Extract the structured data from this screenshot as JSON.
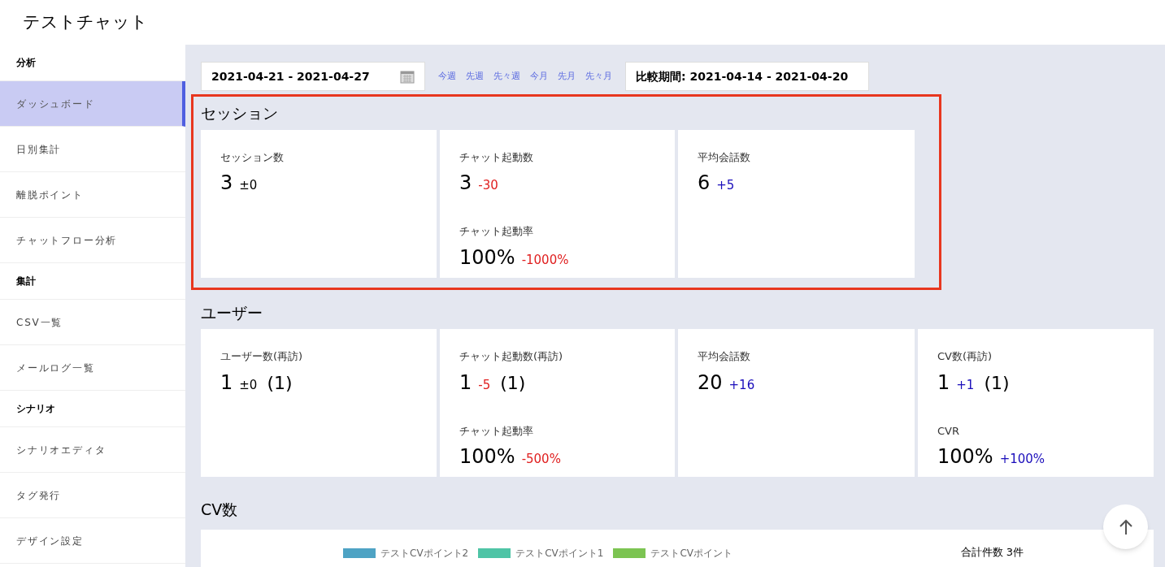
{
  "app": {
    "title": "テストチャット"
  },
  "sidebar": {
    "sections": [
      {
        "label": "分析",
        "items": [
          {
            "label": "ダッシュボード",
            "selected": true
          },
          {
            "label": "日別集計",
            "selected": false
          },
          {
            "label": "離脱ポイント",
            "selected": false
          },
          {
            "label": "チャットフロー分析",
            "selected": false
          }
        ]
      },
      {
        "label": "集計",
        "items": [
          {
            "label": "CSV一覧",
            "selected": false
          },
          {
            "label": "メールログ一覧",
            "selected": false
          }
        ]
      },
      {
        "label": "シナリオ",
        "items": [
          {
            "label": "シナリオエディタ",
            "selected": false
          },
          {
            "label": "タグ発行",
            "selected": false
          },
          {
            "label": "デザイン設定",
            "selected": false
          }
        ]
      }
    ]
  },
  "filters": {
    "date_range": "2021-04-21 - 2021-04-27",
    "presets": [
      "今週",
      "先週",
      "先々週",
      "今月",
      "先月",
      "先々月"
    ],
    "compare": "比較期間: 2021-04-14 - 2021-04-20"
  },
  "sections": [
    {
      "title": "セッション",
      "highlighted": true,
      "cards": [
        {
          "metrics": [
            {
              "label": "セッション数",
              "value": "3",
              "delta": "±0",
              "kind": "even"
            }
          ]
        },
        {
          "metrics": [
            {
              "label": "チャット起動数",
              "value": "3",
              "delta": "-30",
              "kind": "down"
            },
            {
              "label": "チャット起動率",
              "value": "100%",
              "delta": "-1000%",
              "kind": "down"
            }
          ]
        },
        {
          "metrics": [
            {
              "label": "平均会話数",
              "value": "6",
              "delta": "+5",
              "kind": "up"
            }
          ]
        }
      ]
    },
    {
      "title": "ユーザー",
      "highlighted": false,
      "cards": [
        {
          "metrics": [
            {
              "label": "ユーザー数(再訪)",
              "value": "1",
              "delta": "±0",
              "kind": "even",
              "revisit": "(1)"
            }
          ]
        },
        {
          "metrics": [
            {
              "label": "チャット起動数(再訪)",
              "value": "1",
              "delta": "-5",
              "kind": "down",
              "revisit": "(1)"
            },
            {
              "label": "チャット起動率",
              "value": "100%",
              "delta": "-500%",
              "kind": "down"
            }
          ]
        },
        {
          "metrics": [
            {
              "label": "平均会話数",
              "value": "20",
              "delta": "+16",
              "kind": "up"
            }
          ]
        },
        {
          "metrics": [
            {
              "label": "CV数(再訪)",
              "value": "1",
              "delta": "+1",
              "kind": "up",
              "revisit": "(1)"
            },
            {
              "label": "CVR",
              "value": "100%",
              "delta": "+100%",
              "kind": "up"
            }
          ]
        }
      ]
    }
  ],
  "cv": {
    "title": "CV数",
    "legend": [
      {
        "label": "テストCVポイント2",
        "color": "#4ea3c4"
      },
      {
        "label": "テストCVポイント1",
        "color": "#4fc4a6"
      },
      {
        "label": "テストCVポイント",
        "color": "#7cc452"
      }
    ],
    "total": "合計件数 3件"
  }
}
